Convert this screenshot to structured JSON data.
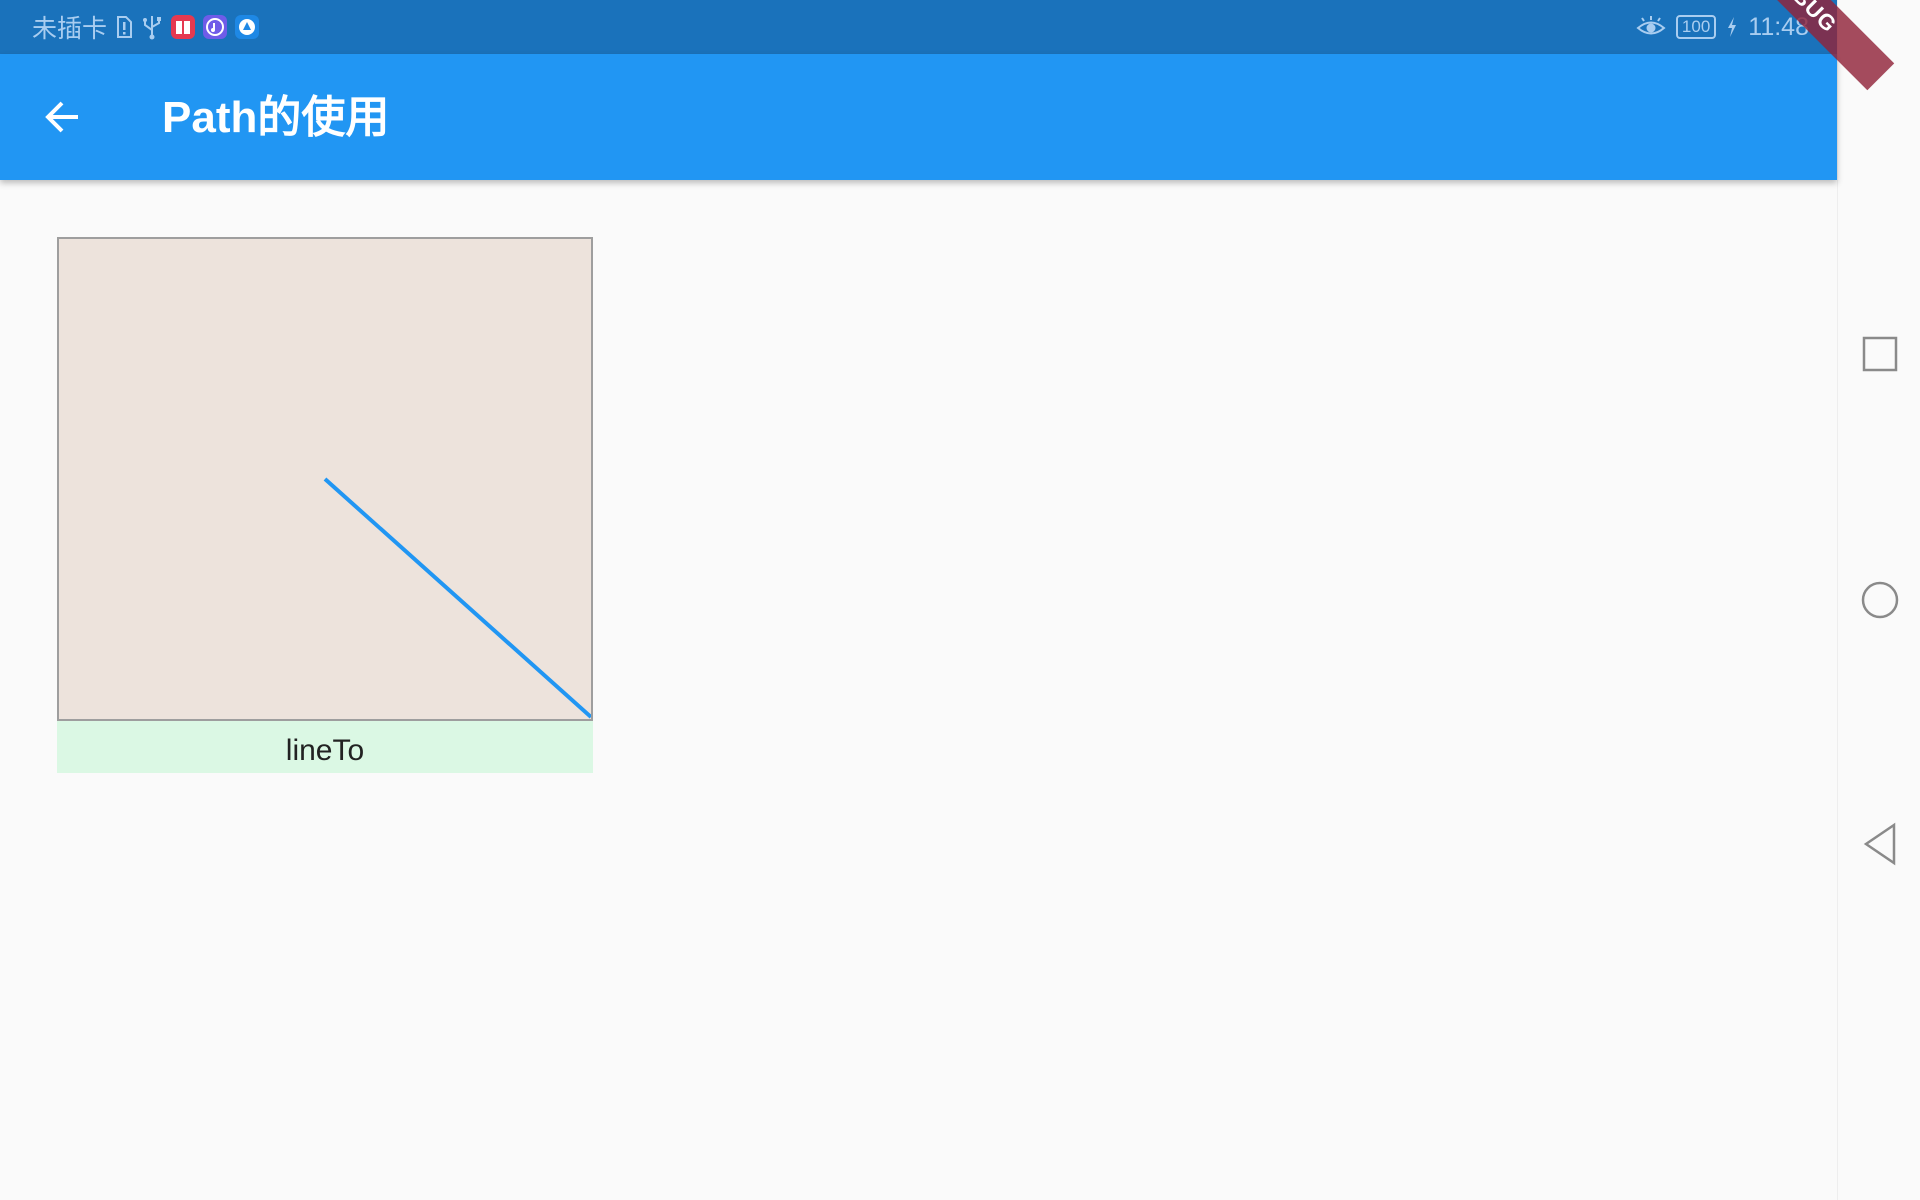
{
  "status_bar": {
    "carrier": "未插卡",
    "time": "11:48",
    "battery": "100",
    "icons": [
      "sim-alert-icon",
      "usb-icon",
      "book-app-icon",
      "music-app-icon",
      "browser-app-icon",
      "eye-comfort-icon",
      "battery-icon",
      "charging-icon"
    ],
    "app_icon_colors": [
      "#e53950",
      "#6f5ce8",
      "#1e88e5"
    ]
  },
  "app_bar": {
    "title": "Path的使用",
    "back_icon": "arrow-back-icon",
    "color": "#2196f3",
    "status_color": "#1a72bb"
  },
  "debug_banner": {
    "label": "DEBUG",
    "color": "#91243a"
  },
  "demo": {
    "caption": "lineTo",
    "canvas_color": "#ede3dc",
    "caption_color": "#dbf8e4",
    "stroke_color": "#2196f3"
  },
  "nav_bar": {
    "buttons": [
      "recents-square-icon",
      "home-circle-icon",
      "back-triangle-icon"
    ]
  }
}
